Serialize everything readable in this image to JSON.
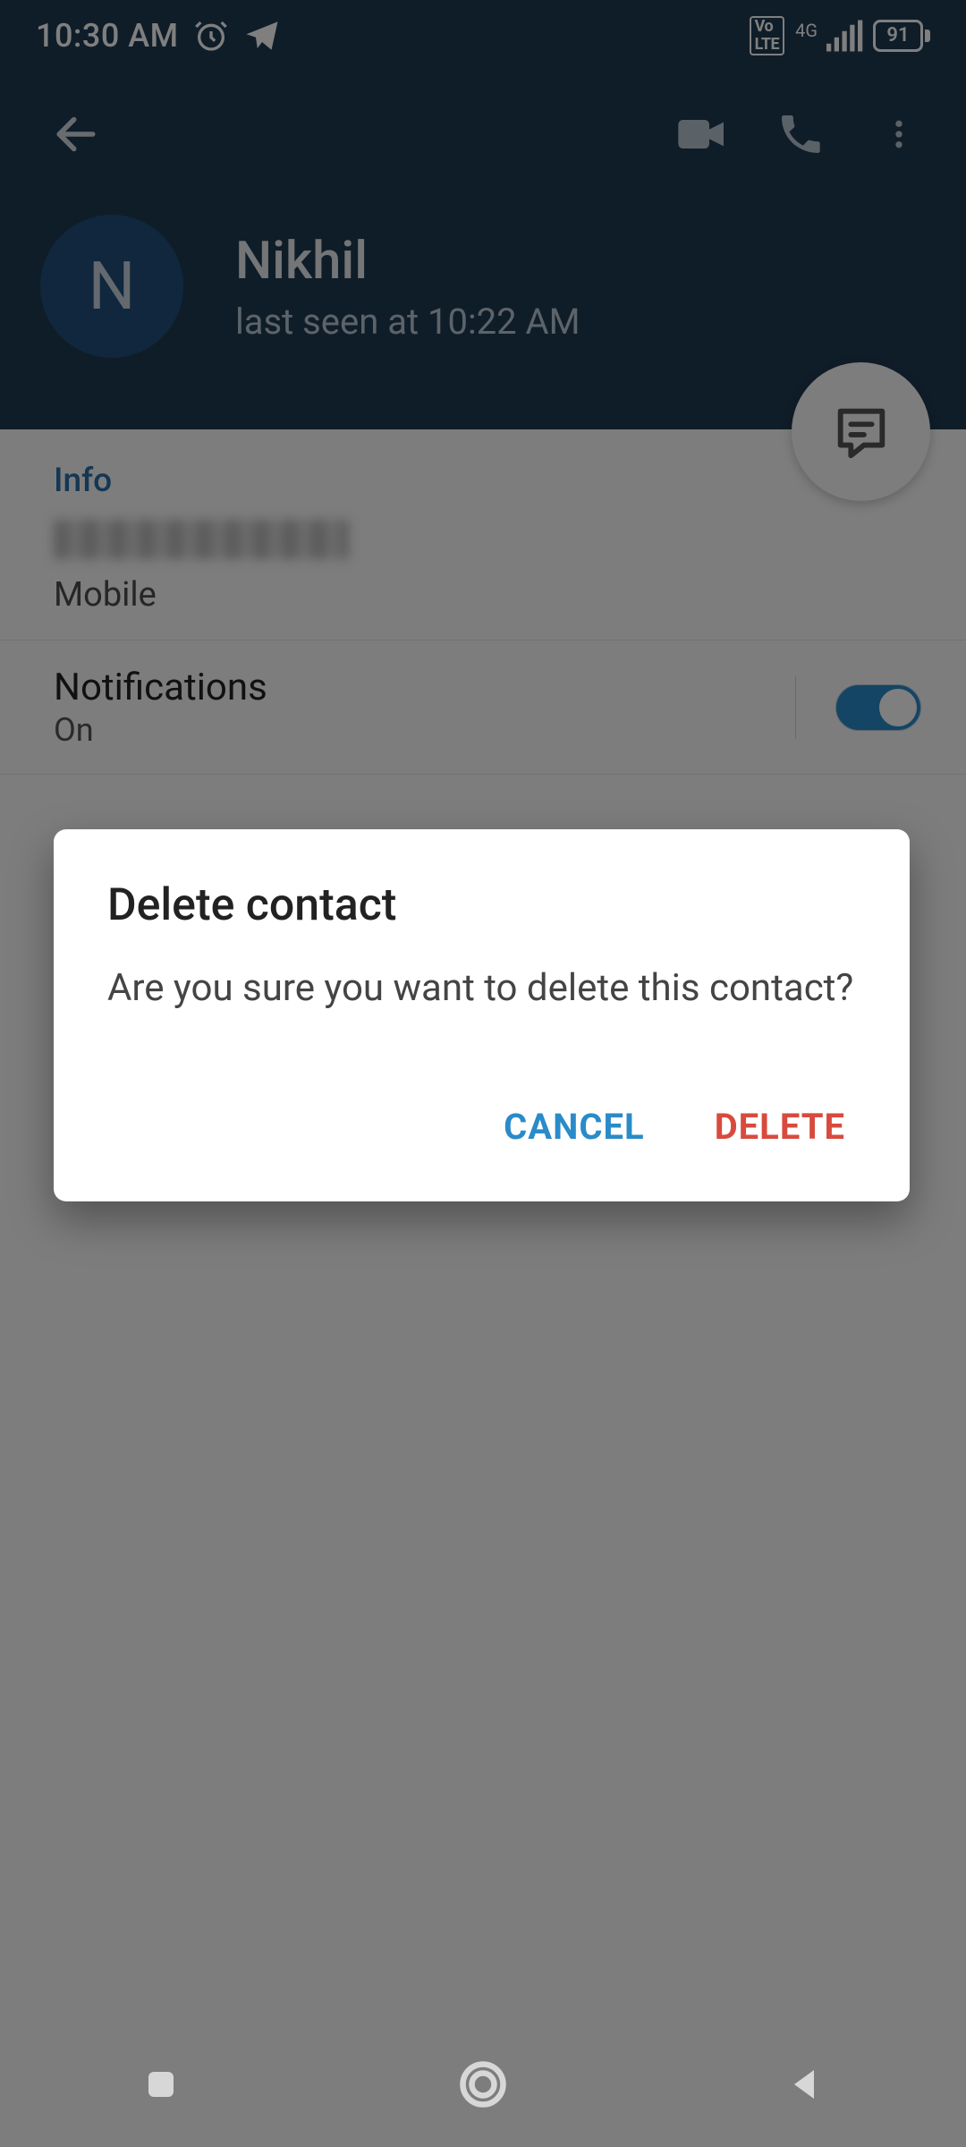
{
  "status": {
    "time": "10:30 AM",
    "network_label": "4G",
    "volte": "VoLTE",
    "battery_text": "91"
  },
  "profile": {
    "avatar_letter": "N",
    "name": "Nikhil",
    "last_seen": "last seen at 10:22 AM"
  },
  "info": {
    "section_title": "Info",
    "phone_label": "Mobile"
  },
  "notifications": {
    "title": "Notifications",
    "state": "On"
  },
  "dialog": {
    "title": "Delete contact",
    "message": "Are you sure you want to delete this contact?",
    "cancel": "CANCEL",
    "delete": "DELETE"
  },
  "colors": {
    "header_bg": "#1f3a52",
    "accent": "#2a8bc8",
    "danger": "#d84a3d"
  }
}
